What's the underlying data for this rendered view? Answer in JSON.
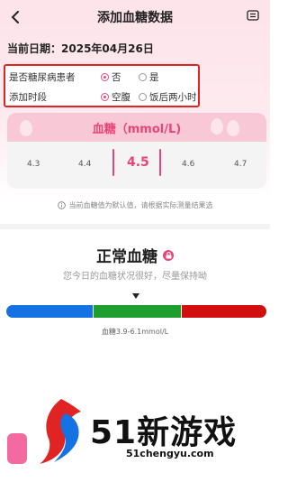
{
  "header": {
    "title": "添加血糖数据",
    "back_icon": "chevron-left-icon",
    "menu_icon": "more-options-icon"
  },
  "date_row": {
    "label": "当前日期：",
    "value": "2025年04月26日"
  },
  "options": {
    "diabetic": {
      "label": "是否糖尿病患者",
      "choices": [
        "否",
        "是"
      ],
      "selected": "否"
    },
    "period": {
      "label": "添加时段",
      "choices": [
        "空腹",
        "饭后两小时"
      ],
      "selected": "空腹"
    }
  },
  "glucose_card": {
    "title": "血糖（mmol/L)",
    "scale": [
      "4.3",
      "4.4",
      "4.5",
      "4.6",
      "4.7"
    ],
    "selected": "4.5"
  },
  "hint": "当前血糖值为默认值，请根据实际测量结果选",
  "status": {
    "title": "正常血糖",
    "description": "您今日的血糖状况很好，尽量保持呦",
    "range_text": "血糖3.9-6.1mmol/L"
  },
  "watermark": {
    "text": "51新游戏",
    "url": "51chengyu.com"
  },
  "colors": {
    "accent": "#e8467a",
    "low": "#1472e3",
    "normal": "#1e9e2e",
    "high": "#d10f0f",
    "highlight_box": "#e02424"
  }
}
